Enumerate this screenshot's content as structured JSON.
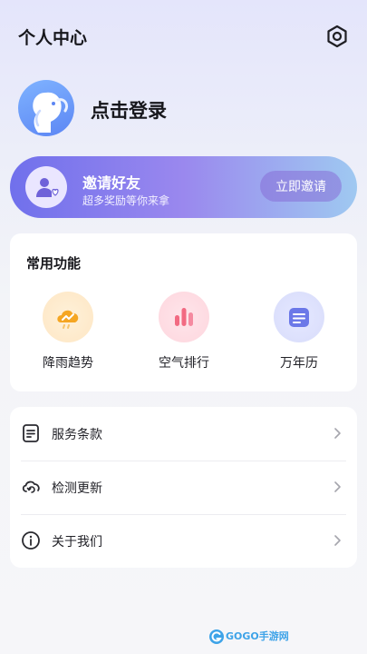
{
  "header": {
    "title": "个人中心",
    "settings_icon": "gear-icon"
  },
  "profile": {
    "login_label": "点击登录",
    "avatar_icon": "elephant-avatar"
  },
  "invite": {
    "title": "邀请好友",
    "subtitle": "超多奖励等你来拿",
    "button_label": "立即邀请",
    "icon": "user-heart-icon"
  },
  "features": {
    "title": "常用功能",
    "items": [
      {
        "label": "降雨趋势",
        "icon": "rain-trend-icon",
        "color": "#f5a623"
      },
      {
        "label": "空气排行",
        "icon": "air-ranking-icon",
        "color": "#f26a82"
      },
      {
        "label": "万年历",
        "icon": "calendar-icon",
        "color": "#6b78e8"
      }
    ]
  },
  "menu": {
    "items": [
      {
        "label": "服务条款",
        "icon": "document-icon"
      },
      {
        "label": "检测更新",
        "icon": "cloud-sync-icon"
      },
      {
        "label": "关于我们",
        "icon": "info-icon"
      }
    ]
  },
  "watermark": {
    "text": "GOGO手游网"
  },
  "colors": {
    "accent": "#7070ec",
    "banner_end": "#9fc9f1"
  }
}
